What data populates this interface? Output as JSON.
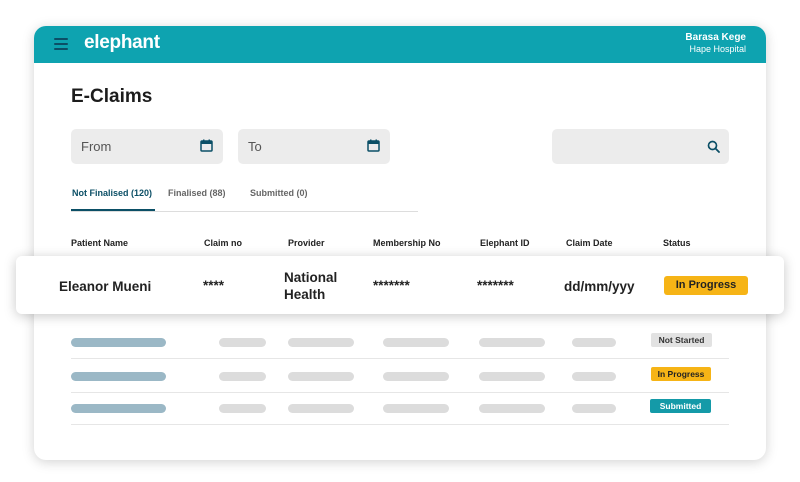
{
  "header": {
    "logo": "elephant",
    "user_name": "Barasa Kege",
    "organization": "Hape Hospital"
  },
  "page_title": "E-Claims",
  "filters": {
    "from_placeholder": "From",
    "to_placeholder": "To",
    "search_placeholder": ""
  },
  "tabs": [
    {
      "label": "Not Finalised (120)"
    },
    {
      "label": "Finalised (88)"
    },
    {
      "label": "Submitted (0)"
    }
  ],
  "columns": [
    "Patient Name",
    "Claim no",
    "Provider",
    "Membership No",
    "Elephant ID",
    "Claim Date",
    "Status"
  ],
  "highlight_row": {
    "patient": "Eleanor Mueni",
    "claim_no": "****",
    "provider_line1": "National",
    "provider_line2": "Health",
    "membership": "*******",
    "elephant_id": "*******",
    "claim_date": "dd/mm/yyy",
    "status": "In Progress"
  },
  "rows": [
    {
      "status": "Not Started"
    },
    {
      "status": "In Progress"
    },
    {
      "status": "Submitted"
    }
  ],
  "colors": {
    "topbar": "#0ea3b0",
    "accent_dark": "#0b4f66",
    "in_progress": "#f6b416",
    "submitted": "#149aa8",
    "not_started": "#e2e2e2"
  }
}
